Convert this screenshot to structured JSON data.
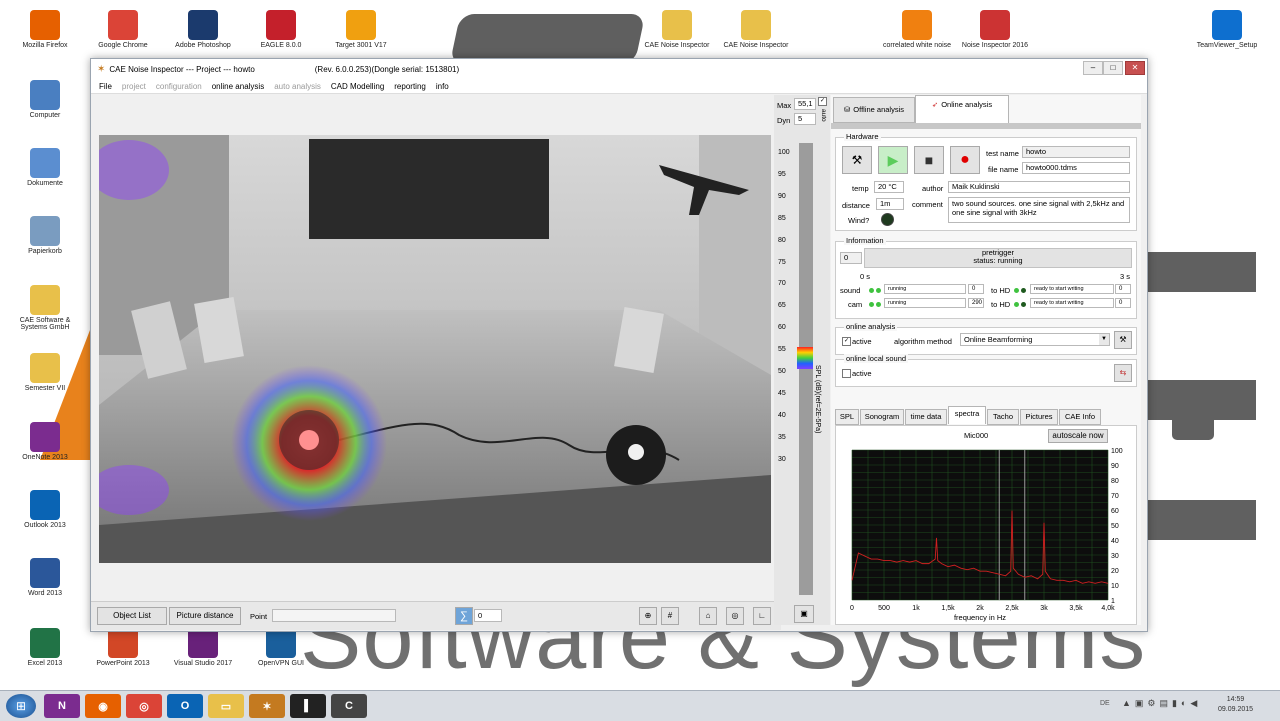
{
  "desktop": {
    "background_text": "Software & Systems",
    "icons": [
      {
        "label": "Mozilla Firefox",
        "icon": "firefox-icon",
        "color": "#e66000"
      },
      {
        "label": "Google Chrome",
        "icon": "chrome-icon",
        "color": "#db4437"
      },
      {
        "label": "Adobe Photoshop",
        "icon": "photoshop-icon",
        "color": "#1b3a6d"
      },
      {
        "label": "EAGLE 8.0.0",
        "icon": "eagle-icon",
        "color": "#c4202b"
      },
      {
        "label": "Target 3001 V17",
        "icon": "target-icon",
        "color": "#f0a010"
      },
      {
        "label": "CAE Noise Inspector",
        "icon": "folder-icon",
        "color": "#e8c04a"
      },
      {
        "label": "CAE Noise Inspector",
        "icon": "folder-icon",
        "color": "#e8c04a"
      },
      {
        "label": "correlated white noise",
        "icon": "vlc-icon",
        "color": "#f08010"
      },
      {
        "label": "Noise Inspector 2016",
        "icon": "app-icon",
        "color": "#cc3333"
      },
      {
        "label": "TeamViewer_Setup",
        "icon": "teamviewer-icon",
        "color": "#0e6fcf"
      },
      {
        "label": "Computer",
        "icon": "computer-icon",
        "color": "#4a7fc1"
      },
      {
        "label": "Dokumente",
        "icon": "documents-icon",
        "color": "#5b8ed0"
      },
      {
        "label": "Papierkorb",
        "icon": "recycle-bin-icon",
        "color": "#7a9cc0"
      },
      {
        "label": "CAE Software & Systems GmbH",
        "icon": "folder-icon",
        "color": "#e8c04a"
      },
      {
        "label": "Semester VII",
        "icon": "folder-icon",
        "color": "#e8c04a"
      },
      {
        "label": "OneNote 2013",
        "icon": "onenote-icon",
        "color": "#7b2c8f"
      },
      {
        "label": "Outlook 2013",
        "icon": "outlook-icon",
        "color": "#0a64b4"
      },
      {
        "label": "Word 2013",
        "icon": "word-icon",
        "color": "#2b579a"
      },
      {
        "label": "Excel 2013",
        "icon": "excel-icon",
        "color": "#217346"
      },
      {
        "label": "PowerPoint 2013",
        "icon": "powerpoint-icon",
        "color": "#d24726"
      },
      {
        "label": "Visual Studio 2017",
        "icon": "visual-studio-icon",
        "color": "#68217a"
      },
      {
        "label": "OpenVPN GUI",
        "icon": "openvpn-icon",
        "color": "#1a5f9c"
      }
    ]
  },
  "window": {
    "title": "CAE Noise Inspector --- Project ---   howto",
    "revision": "(Rev. 6.0.0.253)(Dongle serial: 1513801)",
    "menu": [
      {
        "label": "File",
        "enabled": true
      },
      {
        "label": "project",
        "enabled": false
      },
      {
        "label": "configuration",
        "enabled": false
      },
      {
        "label": "online analysis",
        "enabled": true
      },
      {
        "label": "auto analysis",
        "enabled": false
      },
      {
        "label": "CAD Modelling",
        "enabled": true
      },
      {
        "label": "reporting",
        "enabled": true
      },
      {
        "label": "info",
        "enabled": true
      }
    ]
  },
  "bottom_bar": {
    "object_list": "Object List",
    "picture_distance": "Picture distance",
    "point_label": "Point",
    "sum_value": "0"
  },
  "scale": {
    "max_label": "Max",
    "max_value": "55,1",
    "dyn_label": "Dyn",
    "dyn_value": "5",
    "auto_label": "auto",
    "ticks": [
      "100",
      "95",
      "90",
      "85",
      "80",
      "75",
      "70",
      "65",
      "60",
      "55",
      "50",
      "45",
      "40",
      "35",
      "30"
    ],
    "axis_label": "SPL (dB)(ref=2E-5Pa)"
  },
  "right_panel": {
    "tabs_top": [
      "Offline analysis",
      "Online analysis"
    ],
    "hardware": {
      "title": "Hardware",
      "test_name_label": "test name",
      "test_name": "howto",
      "file_name_label": "file name",
      "file_name": "howto000.tdms",
      "temp_label": "temp",
      "temp": "20 °C",
      "author_label": "author",
      "author": "Maik Kuklinski",
      "distance_label": "distance",
      "distance": "1m",
      "comment_label": "comment",
      "comment": "two sound sources. one sine signal with 2,5kHz and one sine signal with 3kHz",
      "wind_label": "Wind?"
    },
    "information": {
      "title": "Information",
      "pretrigger": "pretrigger",
      "status": "status:  running",
      "counter": "0",
      "time_start": "0 s",
      "time_end": "3 s",
      "sound_label": "sound",
      "cam_label": "cam",
      "sound_status": "running",
      "sound_value": "0",
      "cam_status": "running",
      "cam_value": "290",
      "to_hd_label": "to HD",
      "hd_status": "ready to start writing",
      "hd_value": "0"
    },
    "online_analysis": {
      "title": "online analysis",
      "active_label": "active",
      "algorithm_label": "algorithm method",
      "algorithm_value": "Online Beamforming"
    },
    "online_local_sound": {
      "title": "online local sound",
      "active_label": "active"
    },
    "tabs_bottom": [
      "SPL",
      "Sonogram",
      "time data",
      "spectra",
      "Tacho",
      "Pictures",
      "CAE Info"
    ],
    "active_bottom_tab": "spectra",
    "spectrum": {
      "channel": "Mic000",
      "autoscale": "autoscale now"
    }
  },
  "chart_data": {
    "type": "line",
    "title": "Mic000",
    "xlabel": "frequency in Hz",
    "ylabel": "",
    "x_ticks": [
      "0",
      "500",
      "1k",
      "1,5k",
      "2k",
      "2,5k",
      "3k",
      "3,5k",
      "4,0k"
    ],
    "y_ticks": [
      "100",
      "90",
      "80",
      "70",
      "60",
      "50",
      "40",
      "30",
      "20",
      "10",
      "1"
    ],
    "xlim": [
      0,
      4000
    ],
    "ylim": [
      1,
      100
    ],
    "grid": true,
    "series": [
      {
        "color": "#d02020",
        "x": [
          0,
          100,
          200,
          300,
          400,
          500,
          600,
          700,
          800,
          900,
          1000,
          1100,
          1200,
          1300,
          1320,
          1340,
          1400,
          1500,
          1600,
          1700,
          1800,
          1900,
          2000,
          2100,
          2200,
          2300,
          2400,
          2480,
          2500,
          2520,
          2600,
          2700,
          2800,
          2900,
          2980,
          3000,
          3020,
          3100,
          3200,
          3300,
          3400,
          3500,
          3600,
          3700,
          3800,
          3900,
          4000
        ],
        "y": [
          14,
          32,
          30,
          28,
          28,
          27,
          27,
          26,
          27,
          26,
          27,
          25,
          25,
          28,
          42,
          27,
          25,
          23,
          24,
          22,
          21,
          22,
          20,
          20,
          19,
          18,
          17,
          20,
          60,
          22,
          18,
          16,
          17,
          15,
          18,
          52,
          20,
          15,
          14,
          14,
          13,
          14,
          12,
          13,
          12,
          13,
          12
        ]
      }
    ]
  },
  "taskbar": {
    "language": "DE",
    "time": "14:59",
    "date": "09.09.2015"
  }
}
